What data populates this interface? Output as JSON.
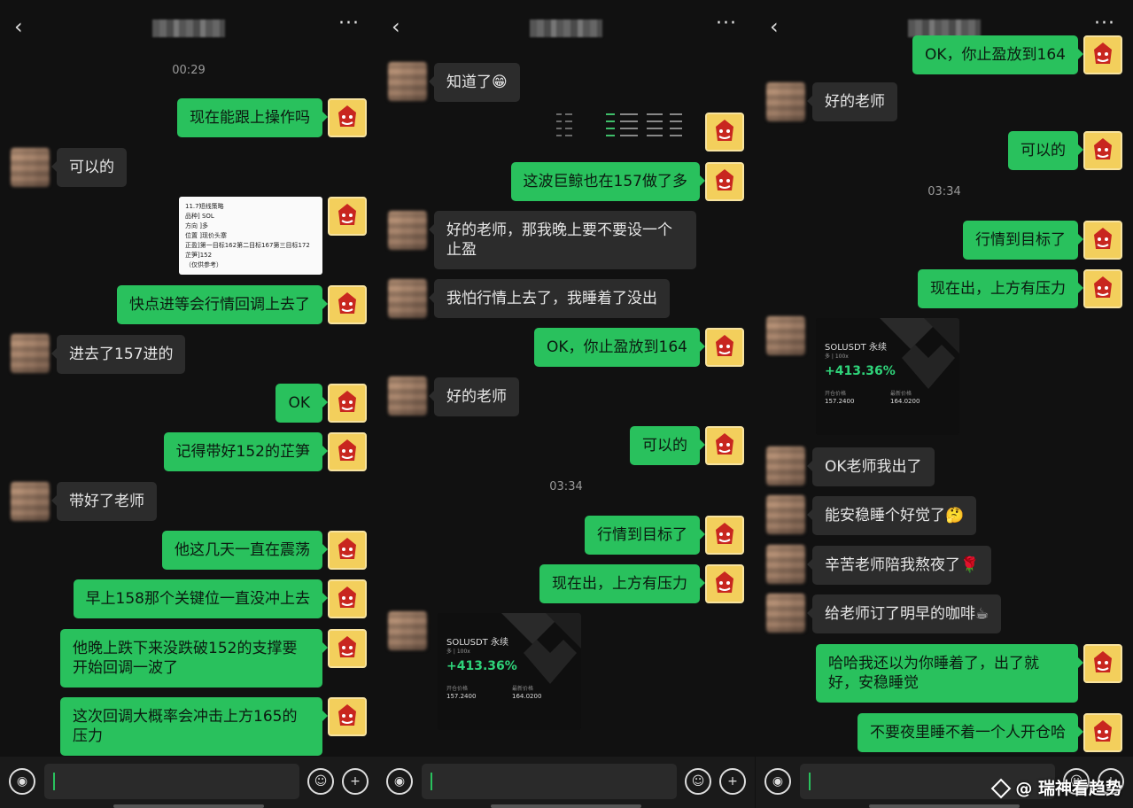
{
  "panels": [
    {
      "time": "00:29",
      "messages": [
        {
          "side": "out",
          "text": "现在能跟上操作吗"
        },
        {
          "side": "in",
          "text": "可以的"
        },
        {
          "side": "out",
          "image": "note",
          "lines": [
            "11.7短线策略",
            "品种] SOL",
            "方向 ]多",
            "位置 ]现价头寨",
            "正盈]第一目标162第二目标167第三目标172",
            "芷笋]152",
            "（仅供参考）"
          ]
        },
        {
          "side": "out",
          "text": "快点进等会行情回调上去了"
        },
        {
          "side": "in",
          "text": "进去了157进的"
        },
        {
          "side": "out",
          "text": "OK"
        },
        {
          "side": "out",
          "text": "记得带好152的芷笋"
        },
        {
          "side": "in",
          "text": "带好了老师"
        },
        {
          "side": "out",
          "text": "他这几天一直在震荡"
        },
        {
          "side": "out",
          "text": "早上158那个关键位一直没冲上去"
        },
        {
          "side": "out",
          "text": "他晚上跌下来没跌破152的支撑要开始回调一波了"
        },
        {
          "side": "out",
          "text": "这次回调大概率会冲击上方165的压力"
        }
      ]
    },
    {
      "time": "03:34",
      "messages": [
        {
          "side": "in",
          "text": "知道了😁"
        },
        {
          "side": "out",
          "image": "screenshot"
        },
        {
          "side": "out",
          "text": "这波巨鲸也在157做了多"
        },
        {
          "side": "in",
          "text": "好的老师，那我晚上要不要设一个止盈"
        },
        {
          "side": "in",
          "text": "我怕行情上去了，我睡着了没出"
        },
        {
          "side": "out",
          "text": "OK，你止盈放到164"
        },
        {
          "side": "in",
          "text": "好的老师"
        },
        {
          "side": "out",
          "text": "可以的"
        },
        {
          "side": "out",
          "text": "行情到目标了"
        },
        {
          "side": "out",
          "text": "现在出，上方有压力"
        },
        {
          "side": "in",
          "image": "pnl-card"
        }
      ]
    },
    {
      "time": "03:34",
      "messages": [
        {
          "side": "out",
          "text": "OK，你止盈放到164"
        },
        {
          "side": "in",
          "text": "好的老师"
        },
        {
          "side": "out",
          "text": "可以的"
        },
        {
          "side": "out",
          "text": "行情到目标了"
        },
        {
          "side": "out",
          "text": "现在出，上方有压力"
        },
        {
          "side": "in",
          "image": "pnl-card"
        },
        {
          "side": "in",
          "text": "OK老师我出了"
        },
        {
          "side": "in",
          "text": "能安稳睡个好觉了🤔"
        },
        {
          "side": "in",
          "text": "辛苦老师陪我熬夜了🌹"
        },
        {
          "side": "in",
          "text": "给老师订了明早的咖啡☕"
        },
        {
          "side": "out",
          "text": "哈哈我还以为你睡着了，出了就好，安稳睡觉"
        },
        {
          "side": "out",
          "text": "不要夜里睡不着一个人开仓哈"
        }
      ]
    }
  ],
  "pnl_card": {
    "symbol": "SOLUSDT 永续",
    "sub": "多 | 100x",
    "pct": "+413.36%",
    "entry_label": "开仓价格",
    "entry": "157.2400",
    "exit_label": "最新价格",
    "exit": "164.0200"
  },
  "ui": {
    "back": "‹",
    "more": "···",
    "voice_icon": "voice-icon",
    "emoji_icon": "emoji-icon",
    "plus_icon": "plus-icon"
  },
  "watermark": "@ 瑞神看趋势",
  "colors": {
    "out_bubble": "#29c15d",
    "in_bubble": "#2c2c2c",
    "bg": "#111111"
  }
}
